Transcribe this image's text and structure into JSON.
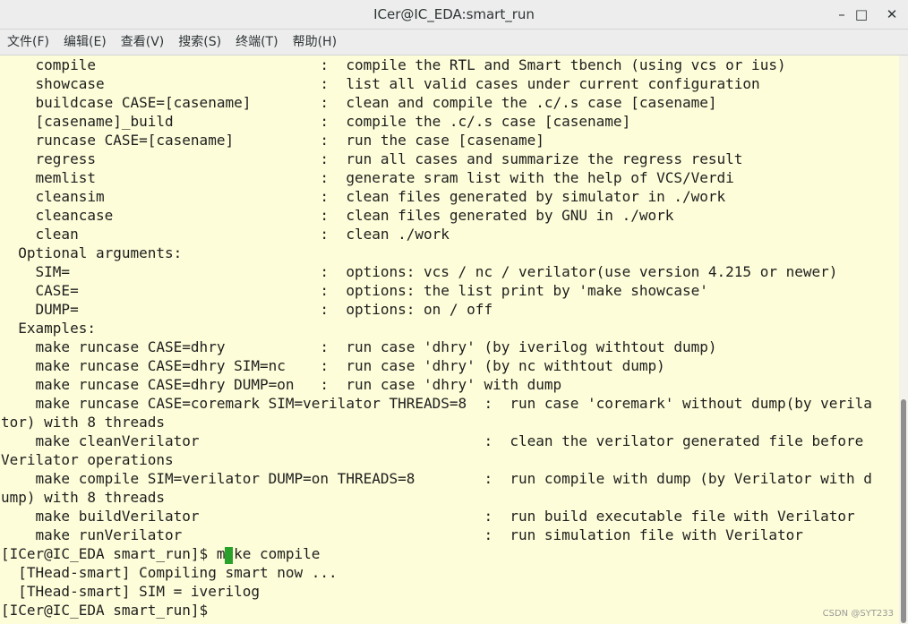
{
  "window": {
    "title": "ICer@IC_EDA:smart_run",
    "minimize_glyph": "–",
    "maximize_glyph": "□",
    "close_glyph": "✕"
  },
  "menu": [
    "文件(F)",
    "编辑(E)",
    "查看(V)",
    "搜索(S)",
    "终端(T)",
    "帮助(H)"
  ],
  "terminal_lines": [
    "    compile                          :  compile the RTL and Smart tbench (using vcs or ius)",
    "    showcase                         :  list all valid cases under current configuration",
    "    buildcase CASE=[casename]        :  clean and compile the .c/.s case [casename]",
    "    [casename]_build                 :  compile the .c/.s case [casename]",
    "    runcase CASE=[casename]          :  run the case [casename]",
    "    regress                          :  run all cases and summarize the regress result",
    "    memlist                          :  generate sram list with the help of VCS/Verdi",
    "    cleansim                         :  clean files generated by simulator in ./work",
    "    cleancase                        :  clean files generated by GNU in ./work",
    "    clean                            :  clean ./work",
    "  Optional arguments:",
    "    SIM=                             :  options: vcs / nc / verilator(use version 4.215 or newer)",
    "    CASE=                            :  options: the list print by 'make showcase'",
    "    DUMP=                            :  options: on / off",
    "  Examples:",
    "    make runcase CASE=dhry           :  run case 'dhry' (by iverilog withtout dump)",
    "    make runcase CASE=dhry SIM=nc    :  run case 'dhry' (by nc withtout dump)",
    "    make runcase CASE=dhry DUMP=on   :  run case 'dhry' with dump",
    "    make runcase CASE=coremark SIM=verilator THREADS=8  :  run case 'coremark' without dump(by verila",
    "tor) with 8 threads",
    "    make cleanVerilator                                 :  clean the verilator generated file before",
    "Verilator operations",
    "    make compile SIM=verilator DUMP=on THREADS=8        :  run compile with dump (by Verilator with d",
    "ump) with 8 threads",
    "    make buildVerilator                                 :  run build executable file with Verilator",
    "    make runVerilator                                   :  run simulation file with Verilator",
    "[ICer@IC_EDA smart_run]$ make compile",
    "  [THead-smart] Compiling smart now ...",
    "  [THead-smart] SIM = iverilog",
    "[ICer@IC_EDA smart_run]$ "
  ],
  "watermark": "CSDN @SYT233",
  "colors": {
    "terminal_background": "#fdfdd9",
    "cursor": "#2aa12a"
  }
}
